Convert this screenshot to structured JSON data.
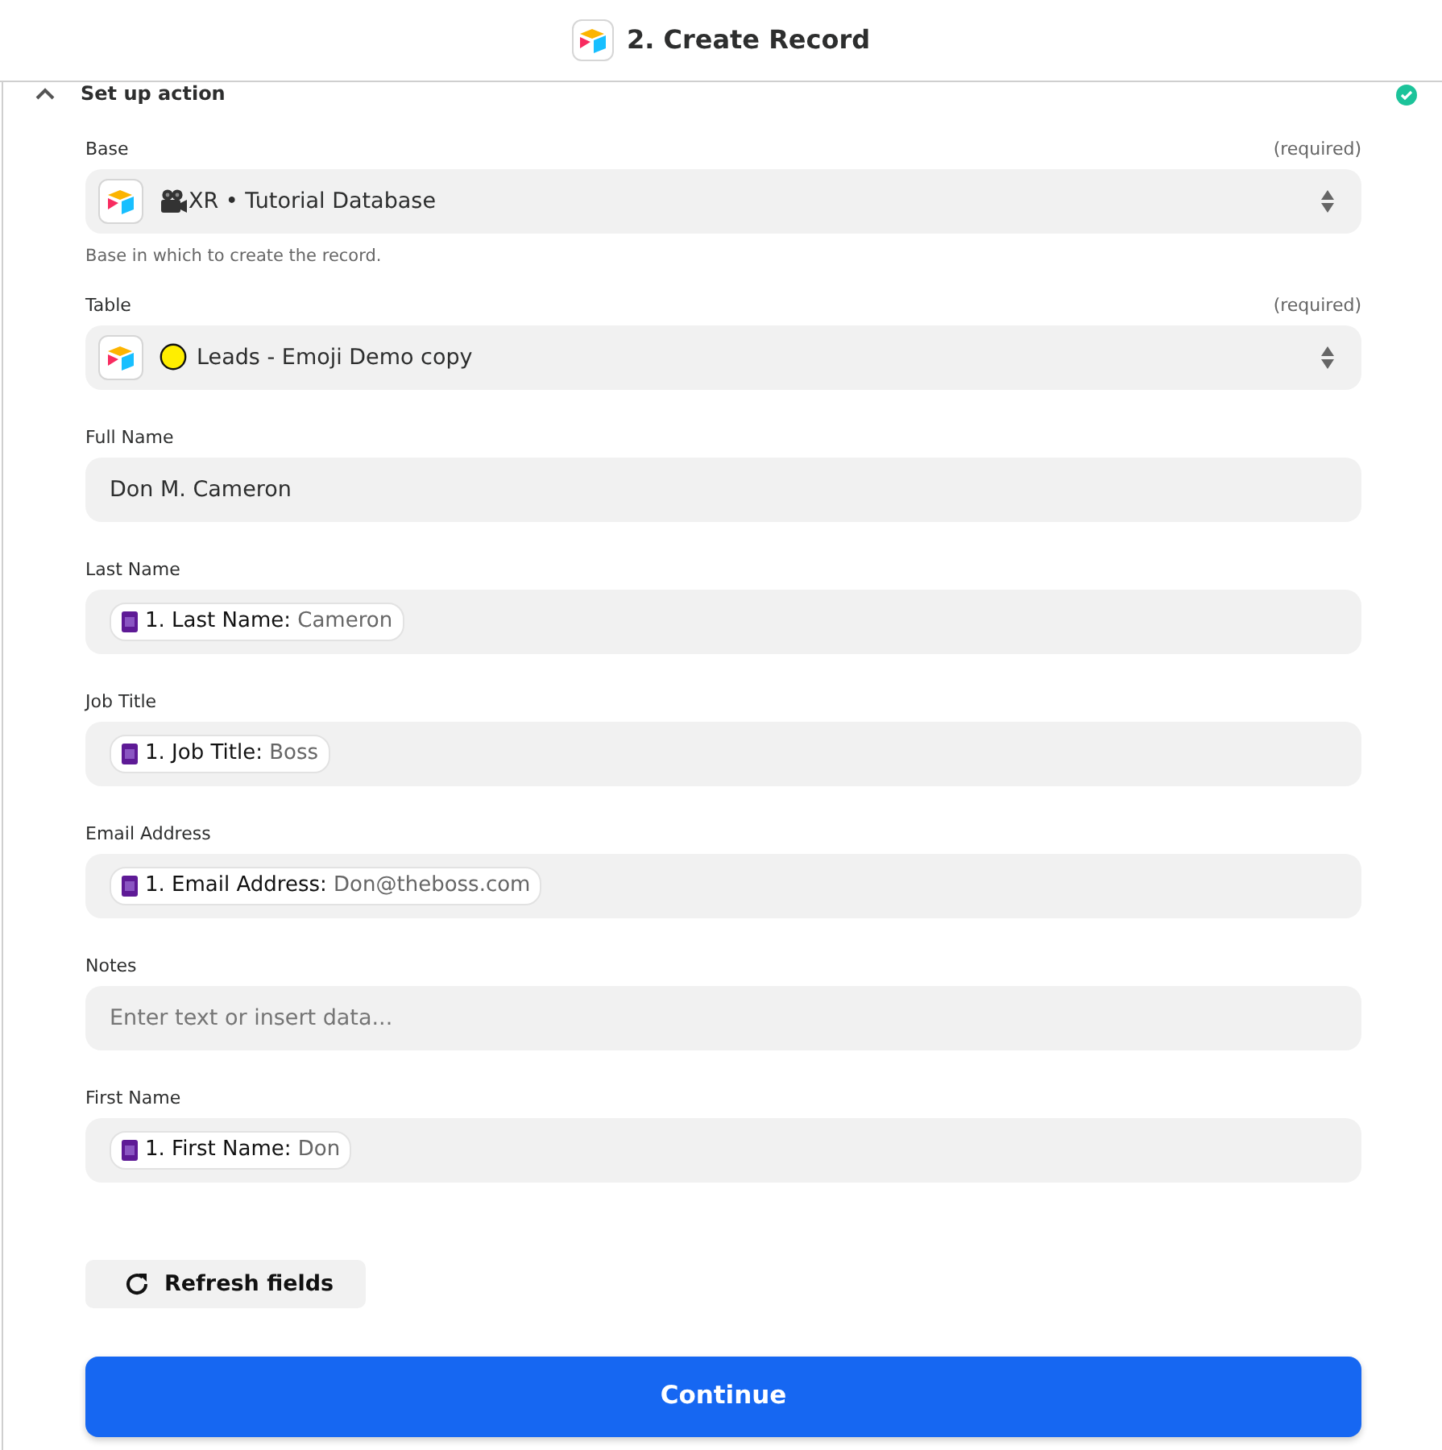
{
  "header": {
    "title": "2. Create Record"
  },
  "section": {
    "title": "Set up action",
    "complete": true
  },
  "fields": [
    {
      "kind": "select",
      "label": "Base",
      "required": "(required)",
      "value": "XR • Tutorial Database",
      "emoji": {
        "kind": "camera"
      },
      "help": "Base in which to create the record."
    },
    {
      "kind": "select",
      "label": "Table",
      "required": "(required)",
      "value": "Leads - Emoji Demo copy",
      "emoji": {
        "kind": "circle"
      }
    },
    {
      "kind": "text",
      "label": "Full Name",
      "value": "Don M. Cameron"
    },
    {
      "kind": "pill",
      "label": "Last Name",
      "pill_label": "1. Last Name:",
      "pill_value": "Cameron"
    },
    {
      "kind": "pill",
      "label": "Job Title",
      "pill_label": "1. Job Title:",
      "pill_value": "Boss"
    },
    {
      "kind": "pill",
      "label": "Email Address",
      "pill_label": "1. Email Address:",
      "pill_value": "Don@theboss.com"
    },
    {
      "kind": "empty",
      "label": "Notes",
      "placeholder": "Enter text or insert data..."
    },
    {
      "kind": "pill",
      "label": "First Name",
      "pill_label": "1. First Name:",
      "pill_value": "Don"
    }
  ],
  "refresh_button": "Refresh fields",
  "continue_button": "Continue"
}
